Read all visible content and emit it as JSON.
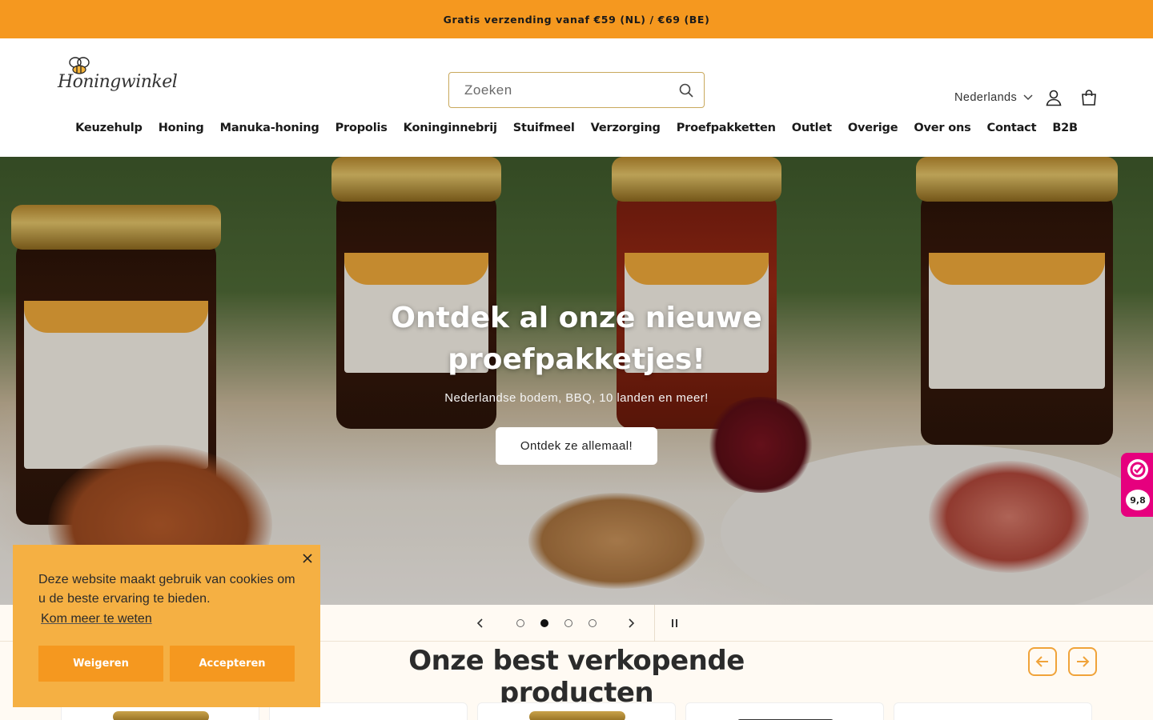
{
  "announcement": {
    "text": "Gratis verzending vanaf €59 (NL) / €69 (BE)"
  },
  "header": {
    "logo_text": "Honingwinkel",
    "search": {
      "placeholder": "Zoeken",
      "value": ""
    },
    "language": "Nederlands",
    "icons": {
      "search": "search-icon",
      "account": "account-icon",
      "cart": "cart-icon",
      "language_toggle": "chevron-down-icon"
    }
  },
  "nav": {
    "items": [
      "Keuzehulp",
      "Honing",
      "Manuka-honing",
      "Propolis",
      "Koninginnebrij",
      "Stuifmeel",
      "Verzorging",
      "Proefpakketten",
      "Outlet",
      "Overige",
      "Over ons",
      "Contact",
      "B2B"
    ]
  },
  "hero": {
    "title": "Ontdek al onze nieuwe proefpakketjes!",
    "subtitle": "Nederlandse bodem, BBQ, 10 landen en meer!",
    "button": "Ontdek ze allemaal!"
  },
  "trust_badge": {
    "score": "9,8"
  },
  "slider": {
    "slides": 4,
    "active": 2,
    "icons": {
      "prev": "chevron-left-icon",
      "next": "chevron-right-icon",
      "pause": "pause-icon"
    }
  },
  "best_sellers": {
    "title": "Onze best verkopende producten"
  },
  "cookie": {
    "message": "Deze website maakt gebruik van cookies om u de beste ervaring te bieden.",
    "learn_more": "Kom meer te weten",
    "decline": "Weigeren",
    "accept": "Accepteren"
  },
  "colors": {
    "accent": "#f5981f",
    "cookie_bg": "#f5b043",
    "trust": "#e6007e"
  }
}
